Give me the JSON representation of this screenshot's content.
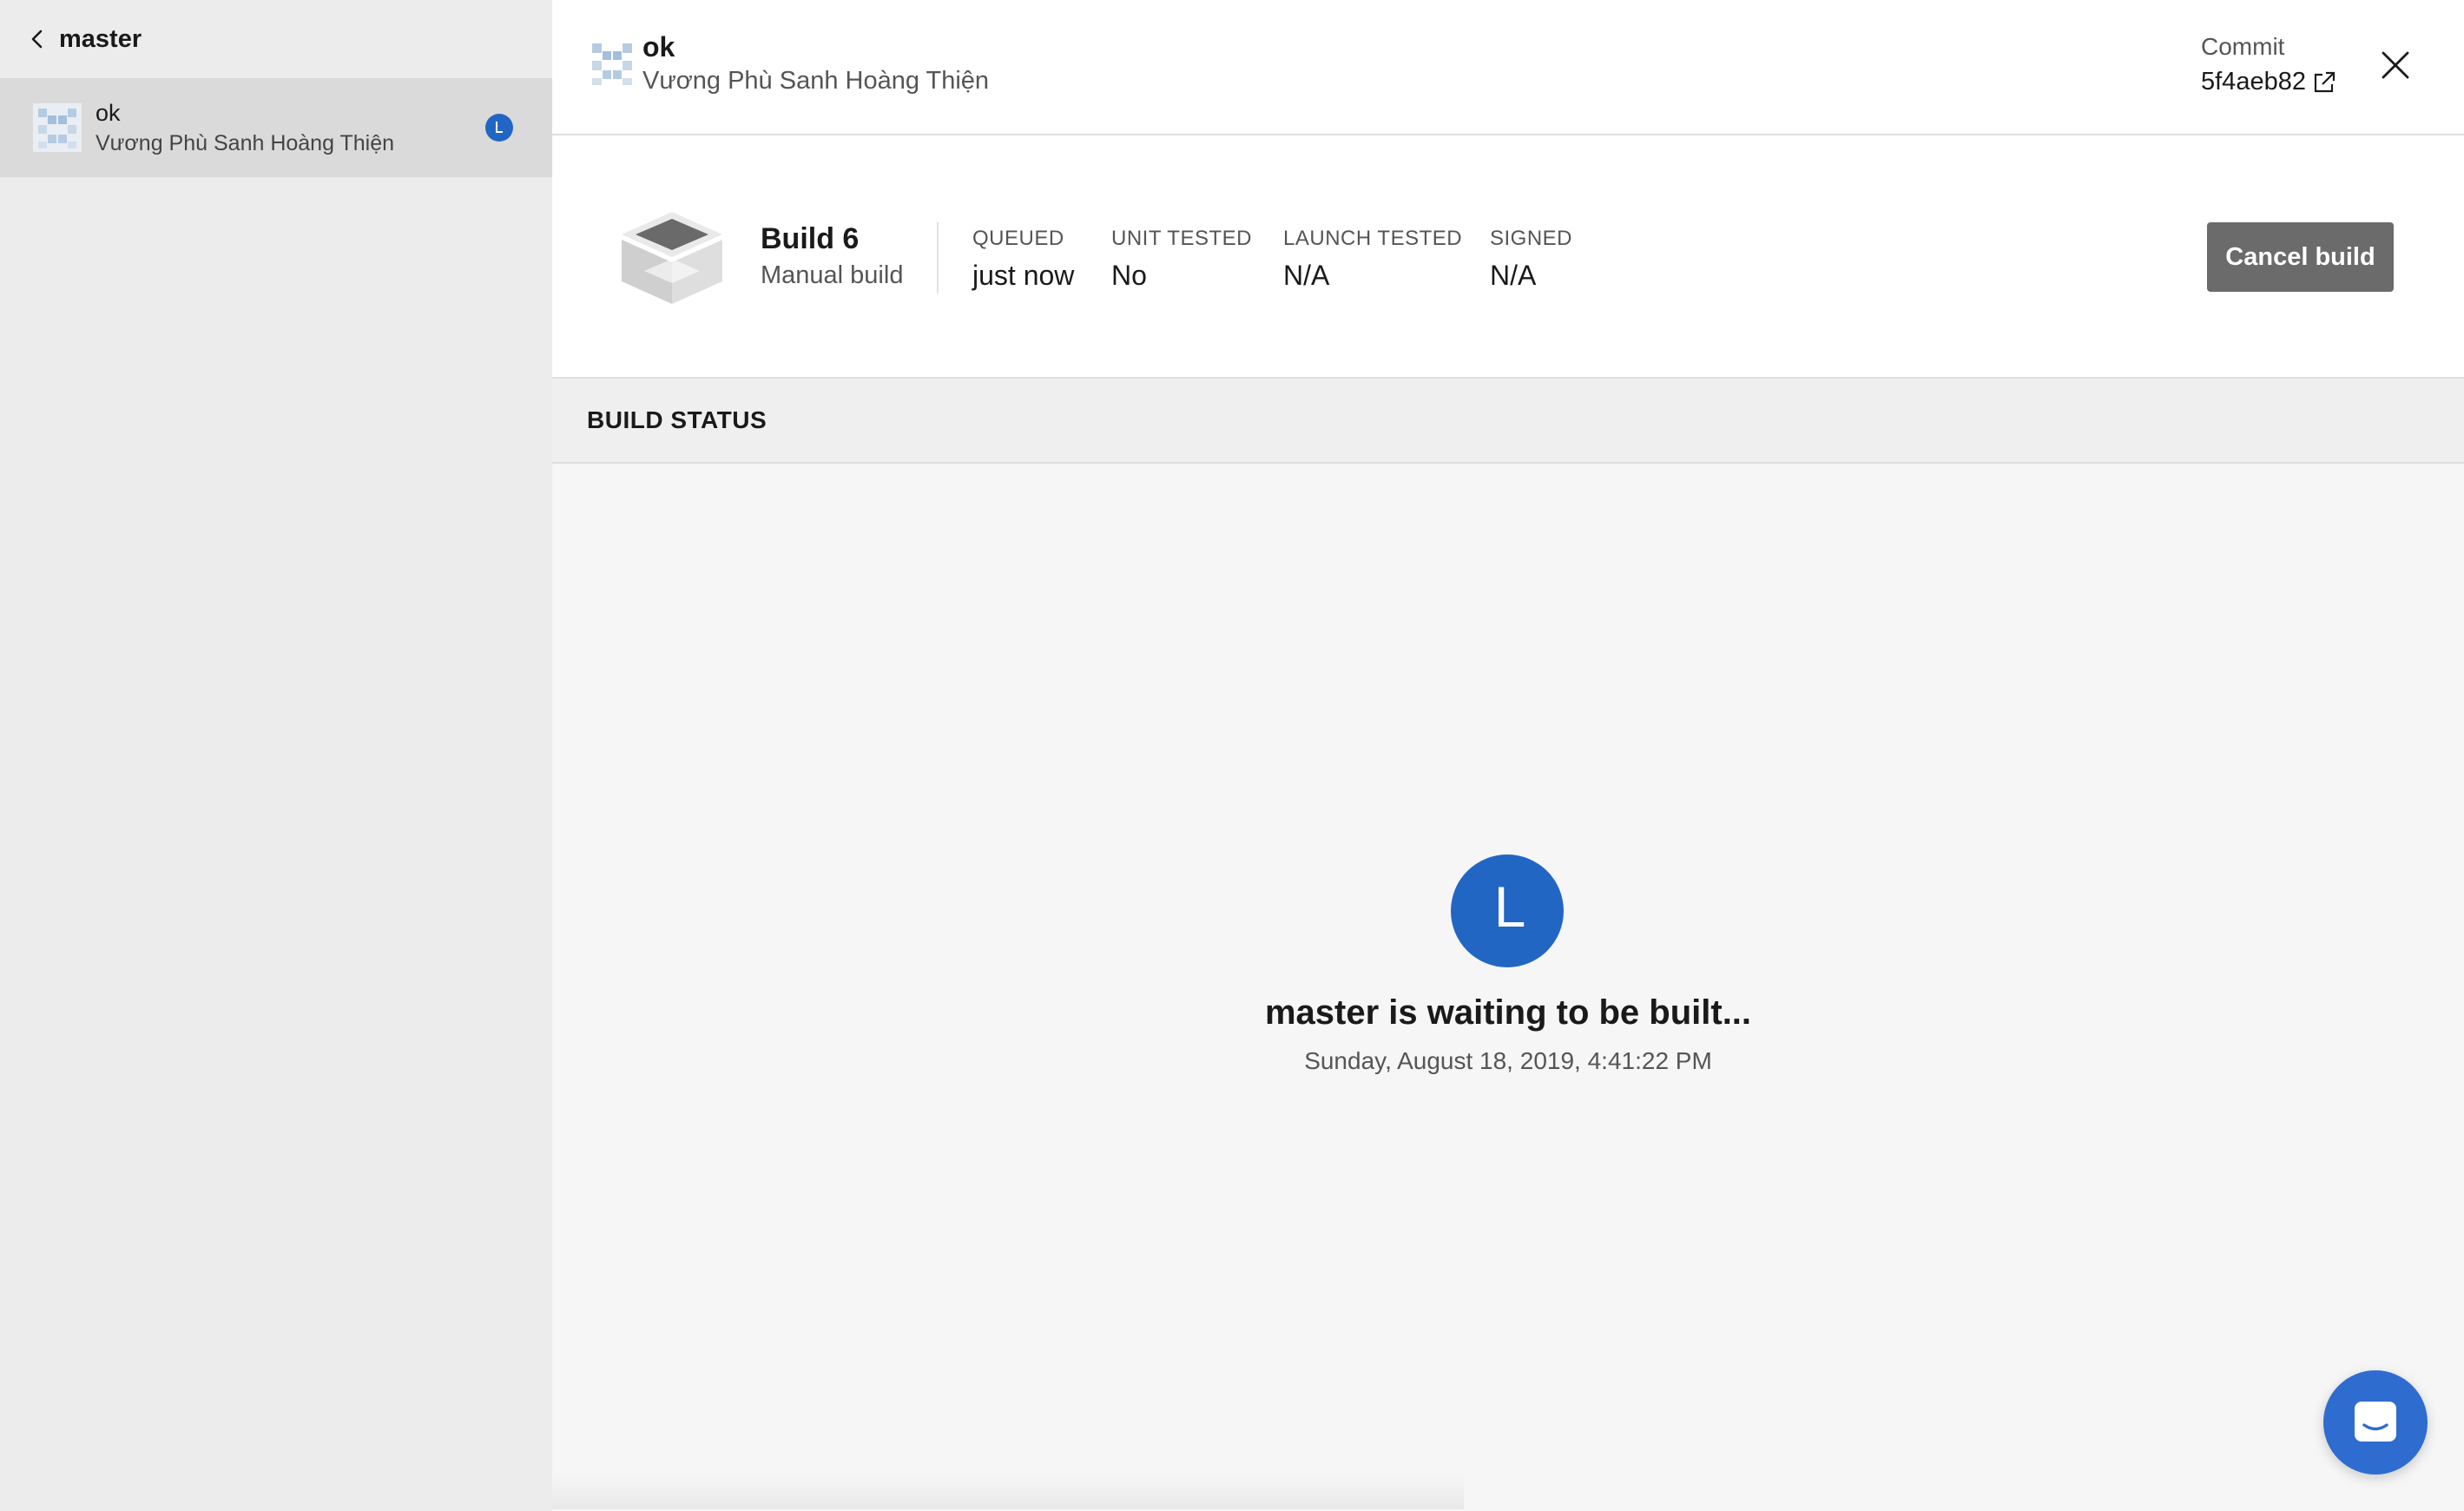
{
  "sidebar": {
    "branch_name": "master",
    "back_icon": "chevron-left-icon",
    "commits": [
      {
        "message": "ok",
        "author": "Vương Phù Sanh Hoàng Thiện",
        "status_icon": "queued-clock-icon"
      }
    ]
  },
  "header": {
    "commit_message": "ok",
    "author": "Vương Phù Sanh Hoàng Thiện",
    "commit_label": "Commit",
    "commit_hash": "5f4aeb82",
    "external_link_icon": "external-link-icon",
    "close_icon": "close-icon"
  },
  "build": {
    "title": "Build 6",
    "subtitle": "Manual build",
    "stats": [
      {
        "label": "QUEUED",
        "value": "just now"
      },
      {
        "label": "UNIT TESTED",
        "value": "No"
      },
      {
        "label": "LAUNCH TESTED",
        "value": "N/A"
      },
      {
        "label": "SIGNED",
        "value": "N/A"
      }
    ],
    "cancel_label": "Cancel build"
  },
  "build_status": {
    "section_title": "BUILD STATUS",
    "avatar_letter": "L",
    "message": "master is waiting to be built...",
    "timestamp": "Sunday, August 18, 2019, 4:41:22 PM"
  },
  "chat": {
    "icon": "chat-icon"
  },
  "colors": {
    "accent_blue": "#2266c4",
    "sidebar_bg": "#ececec",
    "selected_row": "#dadada",
    "cancel_button": "#6b6b6b"
  }
}
